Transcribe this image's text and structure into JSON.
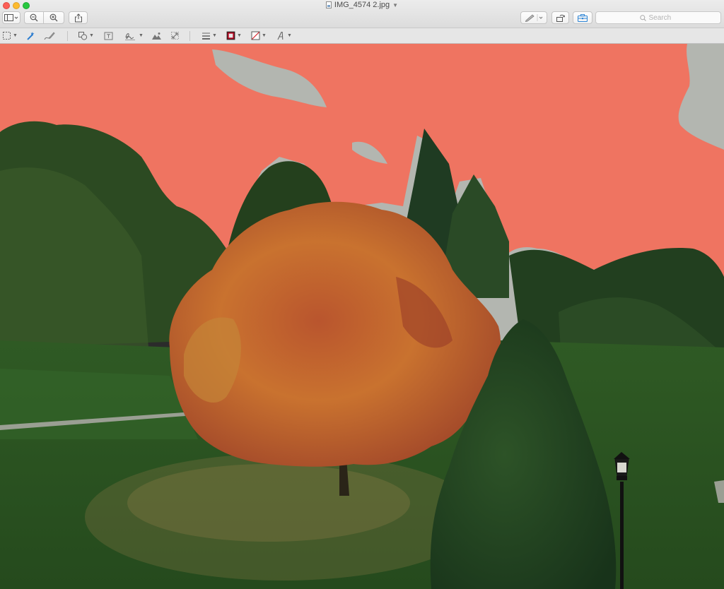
{
  "window": {
    "title": "IMG_4574 2.jpg",
    "file_icon": "jpeg-file-icon"
  },
  "toolbar": {
    "sidebar_toggle_icon": "sidebar-icon",
    "zoom_out_icon": "zoom-out-icon",
    "zoom_in_icon": "zoom-in-icon",
    "share_icon": "share-icon",
    "markup_pen_icon": "pen-icon",
    "rotate_icon": "rotate-icon",
    "toolbox_icon": "toolbox-icon",
    "search": {
      "placeholder": "Search",
      "value": ""
    }
  },
  "markup_toolbar": {
    "tools": [
      {
        "name": "rectangular-selection",
        "icon": "dashed-selection-icon"
      },
      {
        "name": "instant-alpha",
        "icon": "magic-wand-icon"
      },
      {
        "name": "sketch",
        "icon": "sketch-icon"
      },
      {
        "name": "shapes",
        "icon": "shapes-icon"
      },
      {
        "name": "text",
        "icon": "text-box-icon"
      },
      {
        "name": "sign",
        "icon": "signature-icon"
      },
      {
        "name": "adjust-color",
        "icon": "adjust-color-icon"
      },
      {
        "name": "adjust-size",
        "icon": "resize-icon"
      },
      {
        "name": "shape-style",
        "icon": "lines-icon"
      },
      {
        "name": "border-color",
        "icon": "border-color-icon",
        "color": "#c8102e"
      },
      {
        "name": "fill-color",
        "icon": "fill-color-icon"
      },
      {
        "name": "text-style",
        "icon": "font-icon"
      }
    ]
  },
  "colors": {
    "selection_overlay": "#ef7461",
    "traffic_close": "#fc5f57",
    "traffic_min": "#fdbb2e",
    "traffic_max": "#27c840",
    "toolbox_accent": "#2f86d6"
  }
}
